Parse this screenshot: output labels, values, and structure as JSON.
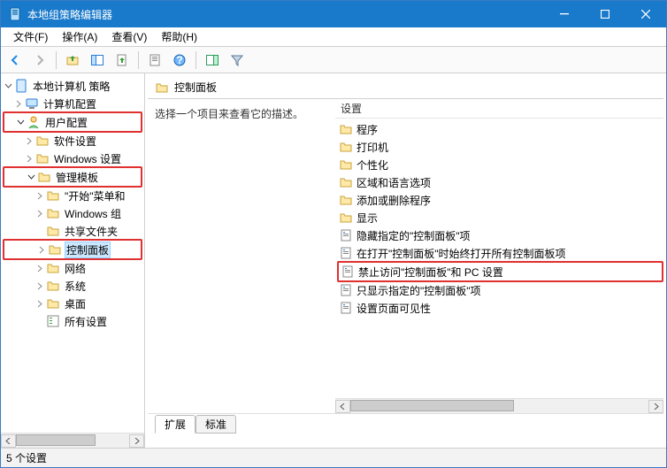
{
  "title": "本地组策略编辑器",
  "menus": {
    "file": "文件(F)",
    "action": "操作(A)",
    "view": "查看(V)",
    "help": "帮助(H)"
  },
  "tree": {
    "root": "本地计算机 策略",
    "n1": "计算机配置",
    "n2": "用户配置",
    "n21": "软件设置",
    "n22": "Windows 设置",
    "n23": "管理模板",
    "n231": "\"开始\"菜单和",
    "n232": "Windows 组",
    "n233": "共享文件夹",
    "n234": "控制面板",
    "n235": "网络",
    "n236": "系统",
    "n237": "桌面",
    "n238": "所有设置"
  },
  "header": "控制面板",
  "desc": "选择一个项目来查看它的描述。",
  "colSettings": "设置",
  "items": {
    "i1": "程序",
    "i2": "打印机",
    "i3": "个性化",
    "i4": "区域和语言选项",
    "i5": "添加或删除程序",
    "i6": "显示",
    "i7": "隐藏指定的\"控制面板\"项",
    "i8": "在打开\"控制面板\"时始终打开所有控制面板项",
    "i9": "禁止访问\"控制面板\"和 PC 设置",
    "i10": "只显示指定的\"控制面板\"项",
    "i11": "设置页面可见性"
  },
  "tabs": {
    "ext": "扩展",
    "std": "标准"
  },
  "status": "5 个设置"
}
